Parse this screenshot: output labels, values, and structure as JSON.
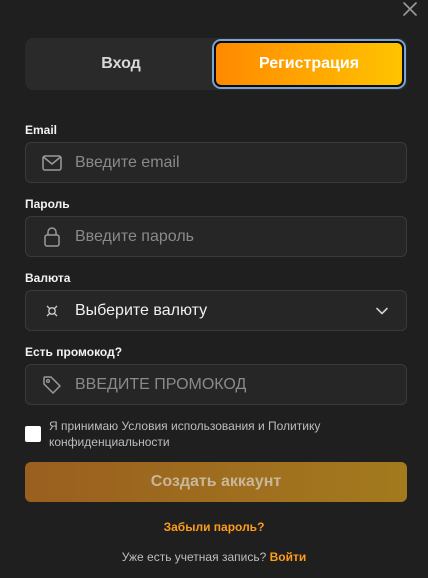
{
  "tabs": {
    "login": "Вход",
    "register": "Регистрация"
  },
  "email": {
    "label": "Email",
    "placeholder": "Введите email"
  },
  "password": {
    "label": "Пароль",
    "placeholder": "Введите пароль"
  },
  "currency": {
    "label": "Валюта",
    "value": "Выберите валюту"
  },
  "promo": {
    "label": "Есть промокод?",
    "placeholder": "ВВЕДИТЕ ПРОМОКОД"
  },
  "terms": {
    "text": "Я принимаю Условия использования и Политику конфиденциальности",
    "checked": false
  },
  "submit_label": "Создать аккаунт",
  "forgot_label": "Забыли пароль?",
  "login_prompt": {
    "text": "Уже есть учетная запись?",
    "link": "Войти"
  },
  "icons": {
    "close": "close-icon",
    "email": "mail-icon",
    "password": "lock-icon",
    "currency": "currency-icon",
    "promo": "tag-icon",
    "select": "chevron-down-icon"
  },
  "colors": {
    "accent": "#ff9b1a",
    "accent_start": "#ff8a00",
    "accent_end": "#ffc300",
    "background": "#1f1f1f"
  }
}
